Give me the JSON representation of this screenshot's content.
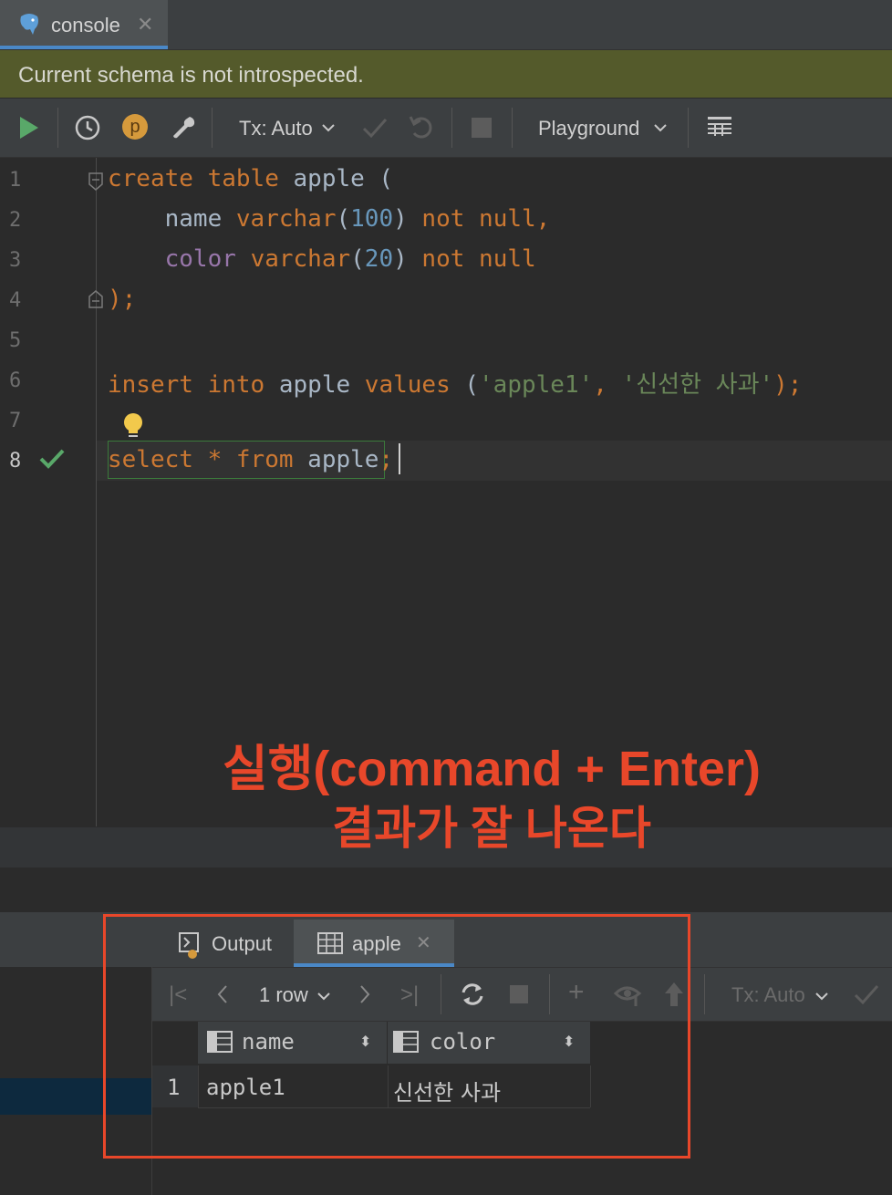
{
  "tab": {
    "label": "console",
    "close": "✕"
  },
  "notice": "Current schema is not introspected.",
  "toolbar": {
    "tx_mode": "Tx: Auto",
    "playground": "Playground",
    "p_badge": "p"
  },
  "editor": {
    "line_numbers": [
      "1",
      "2",
      "3",
      "4",
      "5",
      "6",
      "7",
      "8"
    ],
    "line1": {
      "a": "create",
      "b": "table",
      "c": "apple ("
    },
    "line2": {
      "a": "name",
      "b": "varchar",
      "c": "(",
      "d": "100",
      "e": ")",
      "f": "not",
      "g": "null,"
    },
    "line3": {
      "a": "color",
      "b": "varchar",
      "c": "(",
      "d": "20",
      "e": ")",
      "f": "not",
      "g": "null"
    },
    "line4": {
      "a": ");"
    },
    "line6": {
      "a": "insert",
      "b": "into",
      "c": "apple",
      "d": "values",
      "e": "(",
      "f": "'apple1'",
      "g": ",",
      "h": "'신선한 사과'",
      "i": ");"
    },
    "line8": {
      "a": "select",
      "b": "*",
      "c": "from",
      "d": "apple",
      "e": ";"
    }
  },
  "annotation": {
    "line1": "실행(command + Enter)",
    "line2": "결과가 잘 나온다"
  },
  "results": {
    "tabs": [
      {
        "label": "Output"
      },
      {
        "label": "apple",
        "close": "✕"
      }
    ],
    "row_count": "1 row",
    "tx_mode": "Tx: Auto",
    "columns": [
      "name",
      "color"
    ],
    "rows": [
      {
        "index": "1",
        "cells": [
          "apple1",
          "신선한 사과"
        ]
      }
    ]
  },
  "colors": {
    "accent": "#4a88c7",
    "annotation": "#e8472a",
    "notice_bg": "#545a2b",
    "run_green": "#59a869"
  }
}
